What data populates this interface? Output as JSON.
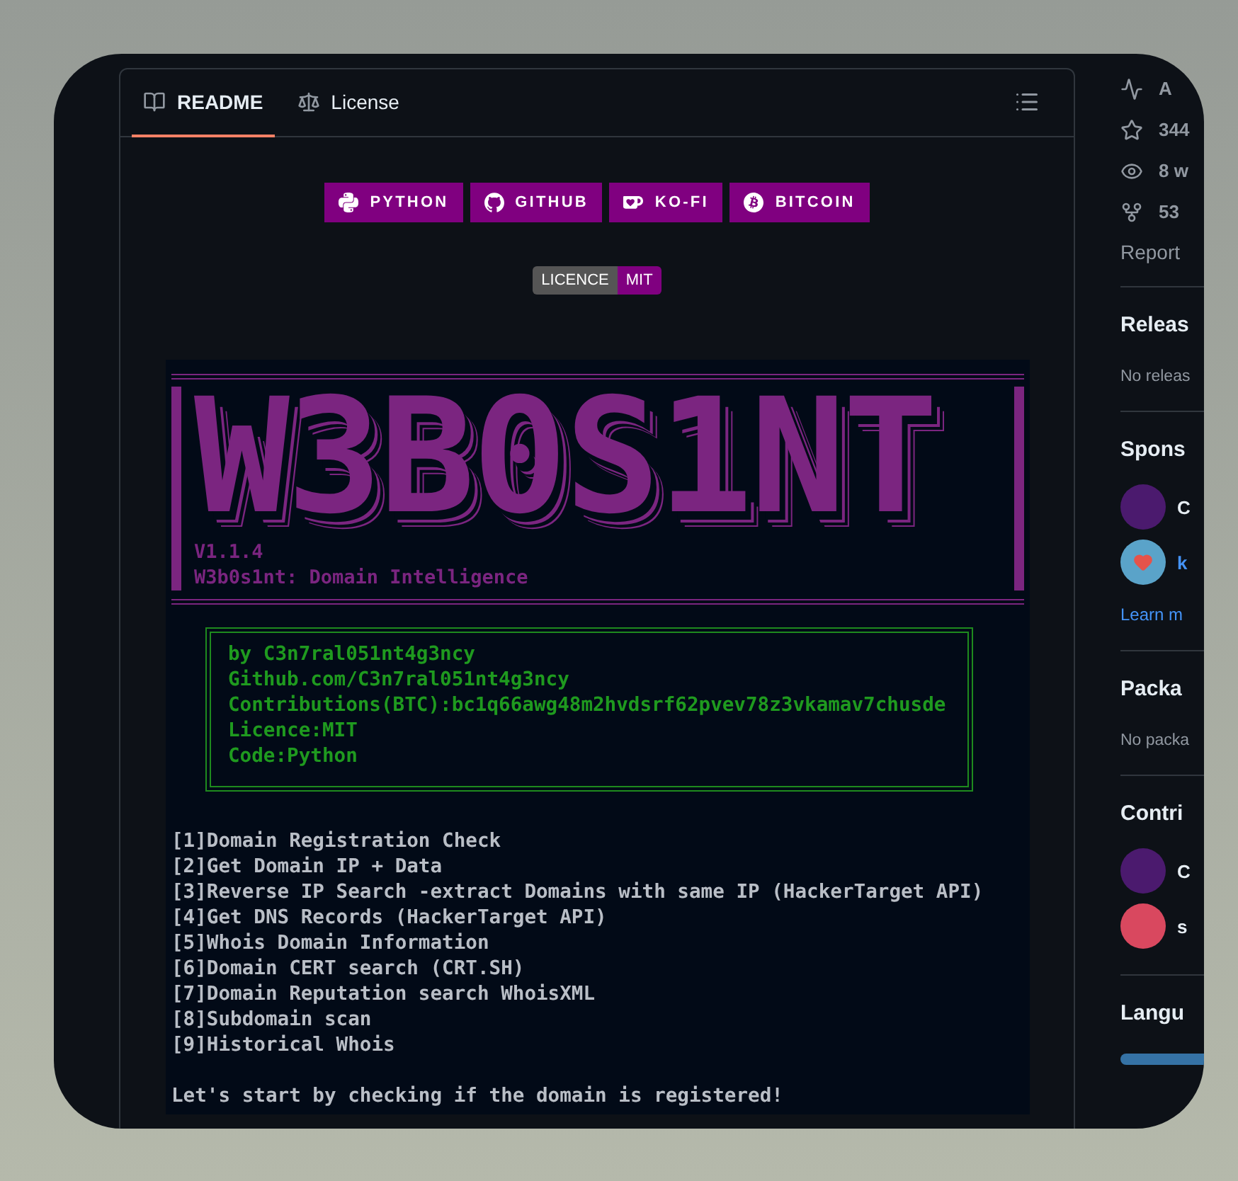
{
  "readme": {
    "tabs": [
      {
        "label": "README",
        "selected": true
      },
      {
        "label": "License",
        "selected": false
      }
    ],
    "badges": [
      {
        "label": "PYTHON"
      },
      {
        "label": "GITHUB"
      },
      {
        "label": "KO-FI"
      },
      {
        "label": "BITCOIN"
      }
    ],
    "license_badge": {
      "key": "LICENCE",
      "value": "MIT"
    },
    "terminal": {
      "title_art": "W3B0S1NT",
      "version": "V1.1.4",
      "subtitle": "W3b0s1nt: Domain Intelligence",
      "credits": [
        "by C3n7ral051nt4g3ncy",
        "Github.com/C3n7ral051nt4g3ncy",
        "Contributions(BTC):bc1q66awg48m2hvdsrf62pvev78z3vkamav7chusde",
        "Licence:MIT",
        "Code:Python"
      ],
      "menu": [
        "[1]Domain Registration Check",
        "[2]Get Domain IP + Data",
        "[3]Reverse IP Search -extract Domains with same IP (HackerTarget API)",
        "[4]Get DNS Records (HackerTarget API)",
        "[5]Whois Domain Information",
        "[6]Domain CERT search (CRT.SH)",
        "[7]Domain Reputation search WhoisXML",
        "[8]Subdomain scan",
        "[9]Historical Whois"
      ],
      "prompt": "Let's start by checking if the domain is registered!"
    }
  },
  "sidebar": {
    "stats": [
      {
        "text": "A"
      },
      {
        "text": "344"
      },
      {
        "text": "8 w"
      },
      {
        "text": "53"
      }
    ],
    "report": "Report",
    "releases": {
      "title": "Releas",
      "empty": "No releas"
    },
    "sponsors": {
      "title": "Spons",
      "people": [
        {
          "name": "C",
          "kind": "person"
        },
        {
          "name": "k",
          "kind": "service"
        }
      ],
      "learn_more": "Learn m"
    },
    "packages": {
      "title": "Packa",
      "empty": "No packa"
    },
    "contributors": {
      "title": "Contri",
      "people": [
        {
          "name": "C"
        },
        {
          "name": "s"
        }
      ]
    },
    "languages": {
      "title": "Langu"
    }
  }
}
